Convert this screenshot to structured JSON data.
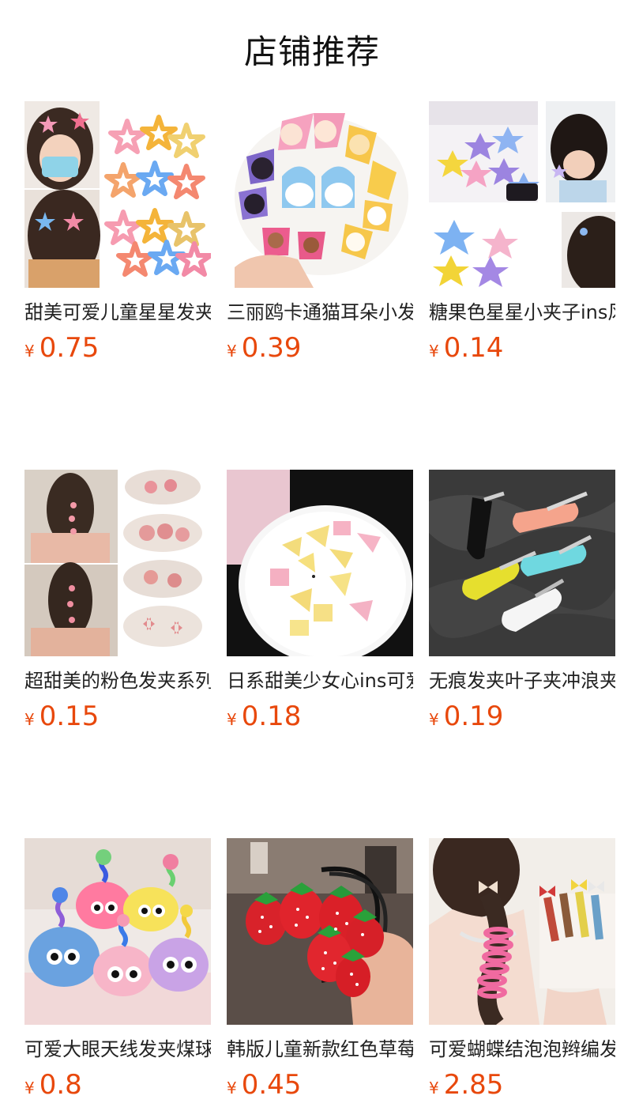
{
  "page_title": "店铺推荐",
  "products": [
    {
      "name": "甜美可爱儿童星星发夹",
      "currency": "¥",
      "price": "0.75",
      "image": "star-hairclip-photo"
    },
    {
      "name": "三丽鸥卡通猫耳朵小发夹",
      "currency": "¥",
      "price": "0.39",
      "image": "sanrio-hairclip-photo"
    },
    {
      "name": "糖果色星星小夹子ins风",
      "currency": "¥",
      "price": "0.14",
      "image": "candy-star-clip-photo"
    },
    {
      "name": "超甜美的粉色发夹系列",
      "currency": "¥",
      "price": "0.15",
      "image": "pink-rose-clip-photo"
    },
    {
      "name": "日系甜美少女心ins可爱",
      "currency": "¥",
      "price": "0.18",
      "image": "cheese-clip-photo"
    },
    {
      "name": "无痕发夹叶子夹冲浪夹",
      "currency": "¥",
      "price": "0.19",
      "image": "seamless-leaf-clip-photo"
    },
    {
      "name": "可爱大眼天线发夹煤球",
      "currency": "¥",
      "price": "0.8",
      "image": "fluffy-eye-clip-photo"
    },
    {
      "name": "韩版儿童新款红色草莓",
      "currency": "¥",
      "price": "0.45",
      "image": "strawberry-hairtie-photo"
    },
    {
      "name": "可爱蝴蝶结泡泡辫编发",
      "currency": "¥",
      "price": "2.85",
      "image": "bow-braid-coil-photo"
    }
  ]
}
